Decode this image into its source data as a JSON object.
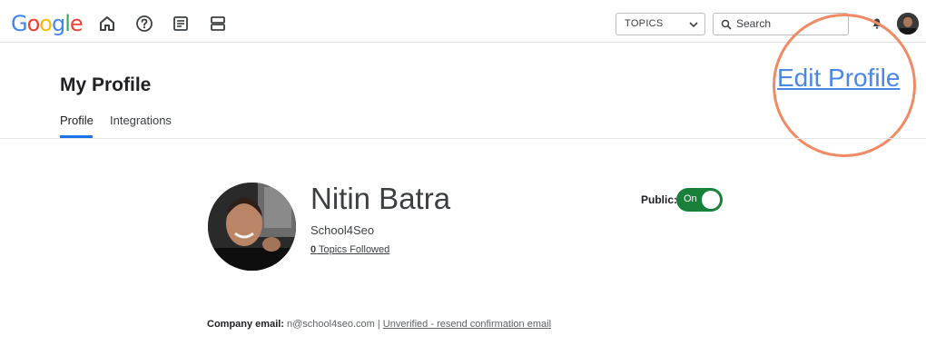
{
  "header": {
    "logo_letters": [
      {
        "char": "G",
        "color": "#4285F4"
      },
      {
        "char": "o",
        "color": "#EA4335"
      },
      {
        "char": "o",
        "color": "#FBBC05"
      },
      {
        "char": "g",
        "color": "#4285F4"
      },
      {
        "char": "l",
        "color": "#34A853"
      },
      {
        "char": "e",
        "color": "#EA4335"
      }
    ],
    "nav_icons": [
      "home-icon",
      "help-icon",
      "article-icon",
      "view-agenda-icon"
    ],
    "topics_label": "TOPICS",
    "search_placeholder": "Search",
    "icons": [
      "bell-icon",
      "avatar"
    ]
  },
  "page": {
    "title": "My Profile",
    "tabs": [
      {
        "label": "Profile",
        "active": true
      },
      {
        "label": "Integrations",
        "active": false
      }
    ],
    "edit_profile_label": "Edit Profile",
    "highlight_color": "#ef8a64"
  },
  "profile": {
    "name": "Nitin Batra",
    "organization": "School4Seo",
    "topics_followed_count": "0",
    "topics_followed_label": " Topics Followed",
    "public_label": "Public:",
    "public_toggle_text": "On",
    "public_on": true,
    "toggle_color": "#188038"
  },
  "email": {
    "label": "Company email:",
    "value": " n@school4seo.com | ",
    "resend_label": "Unverified - resend confirmation email"
  }
}
